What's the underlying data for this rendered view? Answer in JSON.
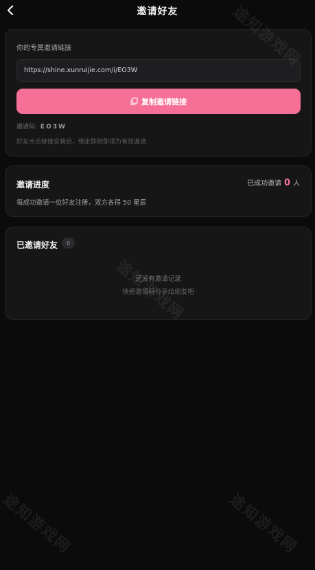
{
  "header": {
    "title": "邀请好友"
  },
  "invite_link": {
    "label": "你的专属邀请链接",
    "url": "https://shine.xunruijie.com/i/EO3W",
    "copy_label": "复制邀请链接",
    "code_label": "邀请码:",
    "code": "EO3W",
    "hint": "好友点击链接安装后，绑定即验即视为有效邀请"
  },
  "progress": {
    "title": "邀请进度",
    "success_label": "已成功邀请",
    "count": "0",
    "unit": "人",
    "desc": "每成功邀请一位好友注册，双方各得 50 星辰"
  },
  "invited": {
    "title": "已邀请好友",
    "count": "0",
    "empty_title": "还没有邀请记录",
    "empty_hint": "快把邀请码分享给朋友吧"
  },
  "watermark": "途知游戏网",
  "colors": {
    "accent": "#f56f96",
    "background": "#0b0b0c",
    "card": "#161617"
  },
  "icons": {
    "back": "chevron-left-icon",
    "copy": "copy-icon"
  }
}
